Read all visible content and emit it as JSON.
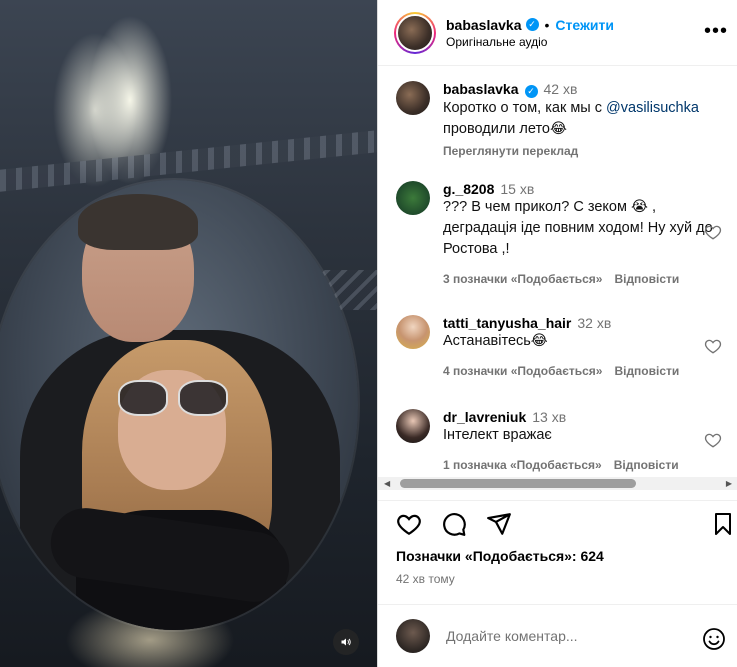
{
  "media": {
    "audio_icon": "speaker-icon"
  },
  "header": {
    "username": "babaslavka",
    "separator": "•",
    "follow_label": "Стежити",
    "audio_label": "Оригінальне аудіо",
    "more_icon": "more-options-icon"
  },
  "caption": {
    "username": "babaslavka",
    "time": "42 хв",
    "text_before": "Коротко о том, как мы с ",
    "mention": "@vasilisuchka",
    "text_after": " проводили лето😂",
    "translate_label": "Переглянути переклад"
  },
  "comments": [
    {
      "username": "g._8208",
      "time": "15 хв",
      "text": "??? В чем прикол? С зеком 😭 , деградація іде повним ходом! Ну хуй до Ростова ,!",
      "likes_label": "3 позначки «Подобається»",
      "reply_label": "Відповісти"
    },
    {
      "username": "tatti_tanyusha_hair",
      "time": "32 хв",
      "text": "Астанавітесь😂",
      "likes_label": "4 позначки «Подобається»",
      "reply_label": "Відповісти"
    },
    {
      "username": "dr_lavreniuk",
      "time": "13 хв",
      "text": "Інтелект вражає",
      "likes_label": "1 позначка «Подобається»",
      "reply_label": "Відповісти"
    }
  ],
  "actions": {
    "like_icon": "heart-icon",
    "comment_icon": "comment-icon",
    "share_icon": "share-icon",
    "save_icon": "bookmark-icon"
  },
  "likes_text": "Позначки «Подобається»: 624",
  "post_time": "42 хв тому",
  "add_comment": {
    "placeholder": "Додайте коментар...",
    "emoji_icon": "smiley-icon"
  },
  "colors": {
    "accent": "#0095f6",
    "secondary_text": "#737373",
    "mention": "#00376b"
  }
}
